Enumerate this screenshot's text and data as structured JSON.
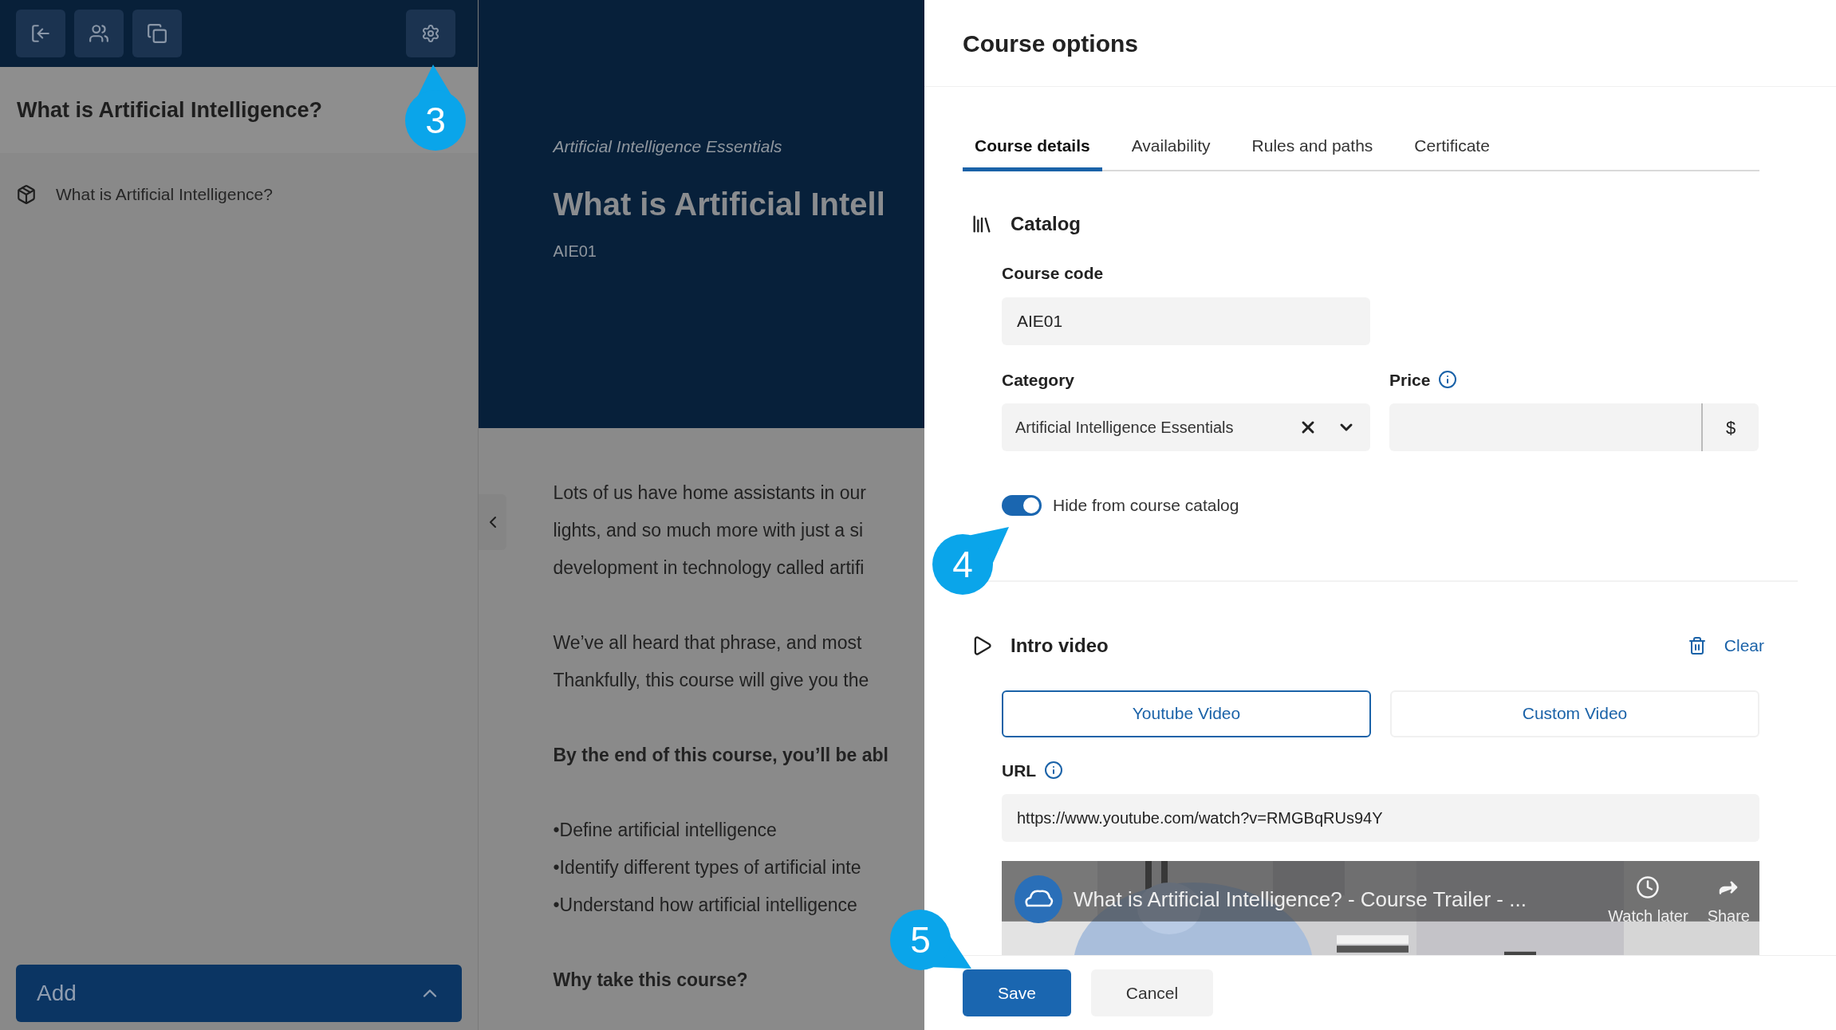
{
  "sidebar": {
    "title": "What is Artificial Intelligence?",
    "items": [
      {
        "label": "What is Artificial Intelligence?"
      }
    ],
    "add_button": "Add"
  },
  "course_header": {
    "subtitle": "Artificial Intelligence Essentials",
    "title": "What is Artificial Intell",
    "code": "AIE01"
  },
  "content": [
    {
      "kind": "paragraph",
      "lines": [
        "Lots of us have home assistants in our",
        "lights, and so much more with just a si",
        "development in technology called artifi"
      ]
    },
    {
      "kind": "paragraph",
      "lines": [
        "We’ve all heard that phrase, and most",
        "Thankfully, this course will give you the"
      ]
    },
    {
      "kind": "heading",
      "lines": [
        "By the end of this course, you’ll be abl"
      ]
    },
    {
      "kind": "paragraph",
      "lines": [
        "•Define artificial intelligence",
        "•Identify different types of artificial inte",
        "•Understand how artificial intelligence"
      ]
    },
    {
      "kind": "heading",
      "lines": [
        "Why take this course?"
      ]
    }
  ],
  "panel": {
    "title": "Course options",
    "tabs": [
      {
        "label": "Course details",
        "selected": true
      },
      {
        "label": "Availability",
        "selected": false
      },
      {
        "label": "Rules and paths",
        "selected": false
      },
      {
        "label": "Certificate",
        "selected": false
      }
    ],
    "catalog": {
      "heading": "Catalog",
      "course_code": {
        "label": "Course code",
        "value": "AIE01"
      },
      "category": {
        "label": "Category",
        "value": "Artificial Intelligence Essentials"
      },
      "price": {
        "label": "Price",
        "currency": "$"
      },
      "hide_toggle": {
        "label": "Hide from course catalog",
        "on": true
      }
    },
    "intro_video": {
      "heading": "Intro video",
      "clear": "Clear",
      "sources": [
        {
          "label": "Youtube Video",
          "selected": true
        },
        {
          "label": "Custom Video",
          "selected": false
        }
      ],
      "url": {
        "label": "URL",
        "value": "https://www.youtube.com/watch?v=RMGBqRUs94Y"
      },
      "video": {
        "title": "What is Artificial Intelligence? - Course Trailer - ...",
        "actions": [
          {
            "kind": "clock",
            "label": "Watch later"
          },
          {
            "kind": "share",
            "label": "Share"
          }
        ]
      }
    },
    "buttons": [
      "Save",
      "Cancel"
    ]
  },
  "callouts": [
    {
      "label": "3"
    },
    {
      "label": "4"
    },
    {
      "label": "5"
    }
  ]
}
